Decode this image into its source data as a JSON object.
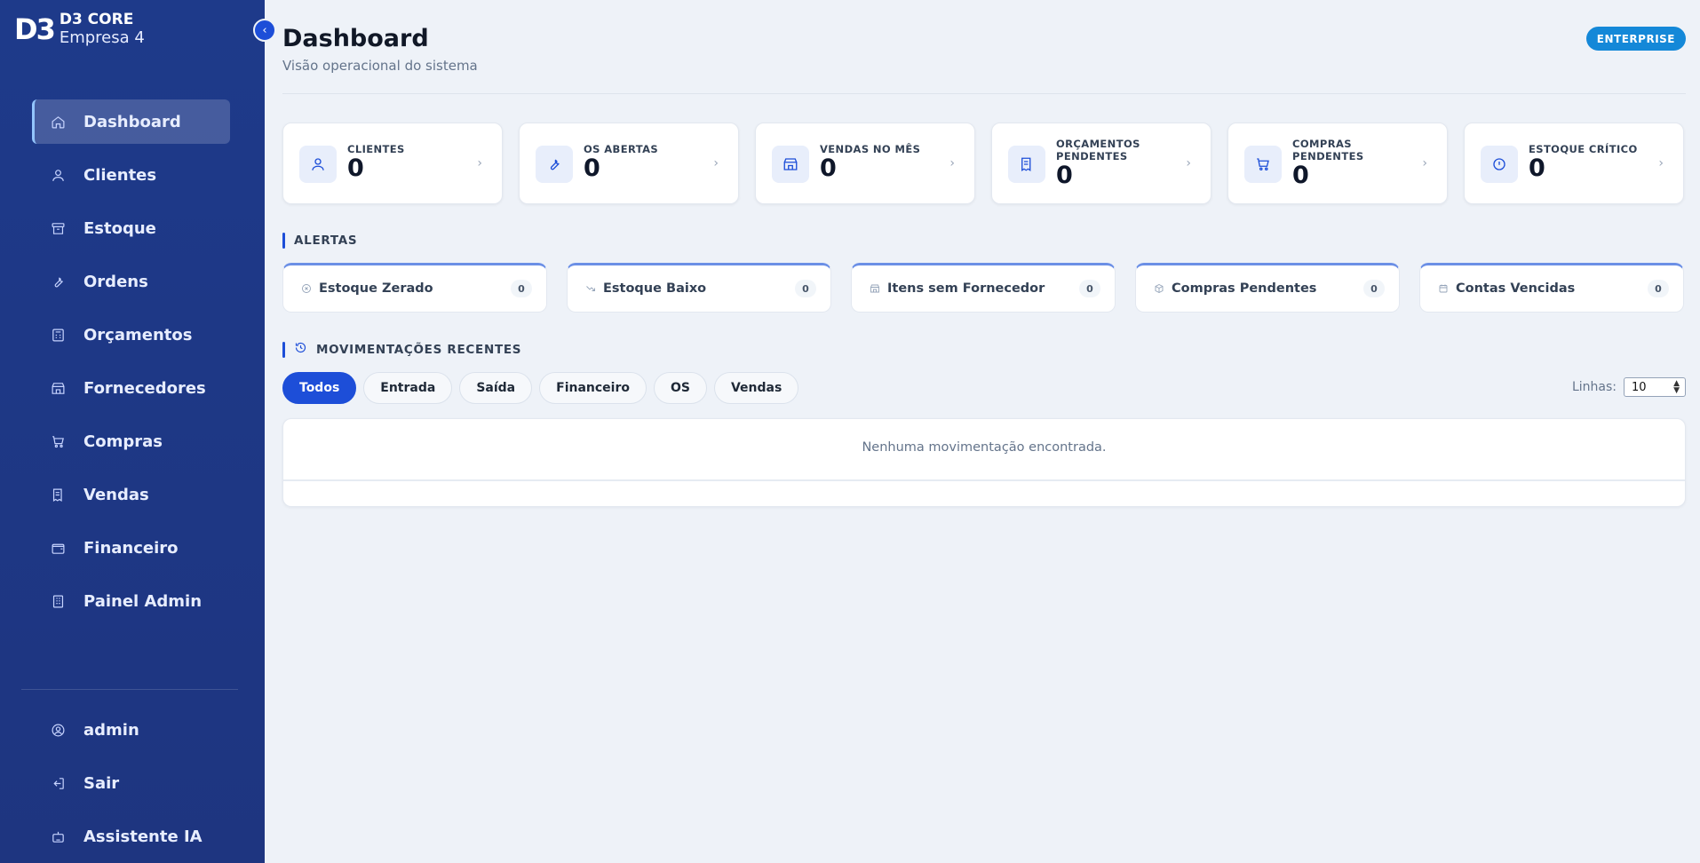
{
  "brand": {
    "logo": "D3",
    "name": "D3 CORE",
    "company": "Empresa 4"
  },
  "sidebar": {
    "items": [
      {
        "label": "Dashboard",
        "icon": "home-icon",
        "active": true
      },
      {
        "label": "Clientes",
        "icon": "user-icon"
      },
      {
        "label": "Estoque",
        "icon": "archive-icon"
      },
      {
        "label": "Ordens",
        "icon": "wrench-icon"
      },
      {
        "label": "Orçamentos",
        "icon": "calculator-icon"
      },
      {
        "label": "Fornecedores",
        "icon": "store-icon"
      },
      {
        "label": "Compras",
        "icon": "cart-icon"
      },
      {
        "label": "Vendas",
        "icon": "receipt-icon"
      },
      {
        "label": "Financeiro",
        "icon": "wallet-icon"
      },
      {
        "label": "Painel Admin",
        "icon": "building-icon"
      }
    ],
    "bottom": [
      {
        "label": "admin",
        "icon": "user-circle-icon"
      },
      {
        "label": "Sair",
        "icon": "logout-icon"
      },
      {
        "label": "Assistente IA",
        "icon": "bot-icon"
      }
    ]
  },
  "header": {
    "title": "Dashboard",
    "subtitle": "Visão operacional do sistema",
    "plan_badge": "ENTERPRISE"
  },
  "stats": [
    {
      "label": "CLIENTES",
      "value": "0",
      "icon": "user-icon"
    },
    {
      "label": "OS ABERTAS",
      "value": "0",
      "icon": "wrench-icon"
    },
    {
      "label": "VENDAS NO MÊS",
      "value": "0",
      "icon": "store-icon"
    },
    {
      "label": "ORÇAMENTOS PENDENTES",
      "value": "0",
      "icon": "receipt-icon"
    },
    {
      "label": "COMPRAS PENDENTES",
      "value": "0",
      "icon": "cart-icon"
    },
    {
      "label": "ESTOQUE CRÍTICO",
      "value": "0",
      "icon": "alert-circle-icon"
    }
  ],
  "alerts": {
    "title": "ALERTAS",
    "items": [
      {
        "label": "Estoque Zerado",
        "count": "0",
        "icon": "x-circle-icon"
      },
      {
        "label": "Estoque Baixo",
        "count": "0",
        "icon": "trend-down-icon"
      },
      {
        "label": "Itens sem Fornecedor",
        "count": "0",
        "icon": "store-icon"
      },
      {
        "label": "Compras Pendentes",
        "count": "0",
        "icon": "package-icon"
      },
      {
        "label": "Contas Vencidas",
        "count": "0",
        "icon": "calendar-icon"
      }
    ]
  },
  "movements": {
    "title": "MOVIMENTAÇÕES RECENTES",
    "filters": [
      "Todos",
      "Entrada",
      "Saída",
      "Financeiro",
      "OS",
      "Vendas"
    ],
    "active_filter": "Todos",
    "rows_label": "Linhas:",
    "rows_value": "10",
    "empty_message": "Nenhuma movimentação encontrada."
  },
  "colors": {
    "sidebar": "#1e3a8a",
    "accent": "#1d4ed8",
    "badge": "#1488d8"
  }
}
